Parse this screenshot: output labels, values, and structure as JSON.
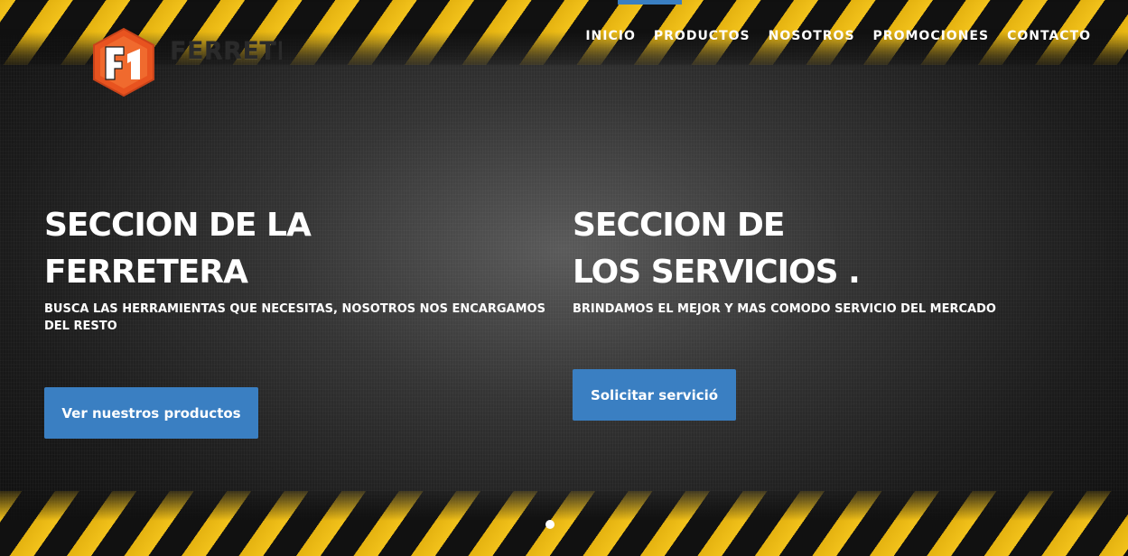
{
  "brand": {
    "name": "FERRETERA"
  },
  "nav": {
    "items": [
      {
        "label": "INICIO"
      },
      {
        "label": "PRODUCTOS"
      },
      {
        "label": "NOSOTROS"
      },
      {
        "label": "PROMOCIONES"
      },
      {
        "label": "CONTACTO"
      }
    ]
  },
  "sections": {
    "ferretera": {
      "title_line1": "SECCION DE LA",
      "title_line2": "FERRETERA",
      "subtitle": "BUSCA LAS HERRAMIENTAS QUE NECESITAS, NOSOTROS NOS ENCARGAMOS DEL RESTO",
      "button_label": "Ver nuestros productos"
    },
    "servicios": {
      "title_line1": "SECCION DE",
      "title_line2": "LOS SERVICIOS .",
      "subtitle": "BRINDAMOS EL MEJOR Y MAS COMODO SERVICIO DEL MERCADO",
      "button_label": "Solicitar servició"
    }
  },
  "colors": {
    "accent": "#3a7fc2",
    "stripe_yellow": "#f2c21b",
    "logo_orange": "#e8531f"
  },
  "icons": {
    "logo": "hexagon-f-logo-icon",
    "carousel_dot": "carousel-dot"
  }
}
